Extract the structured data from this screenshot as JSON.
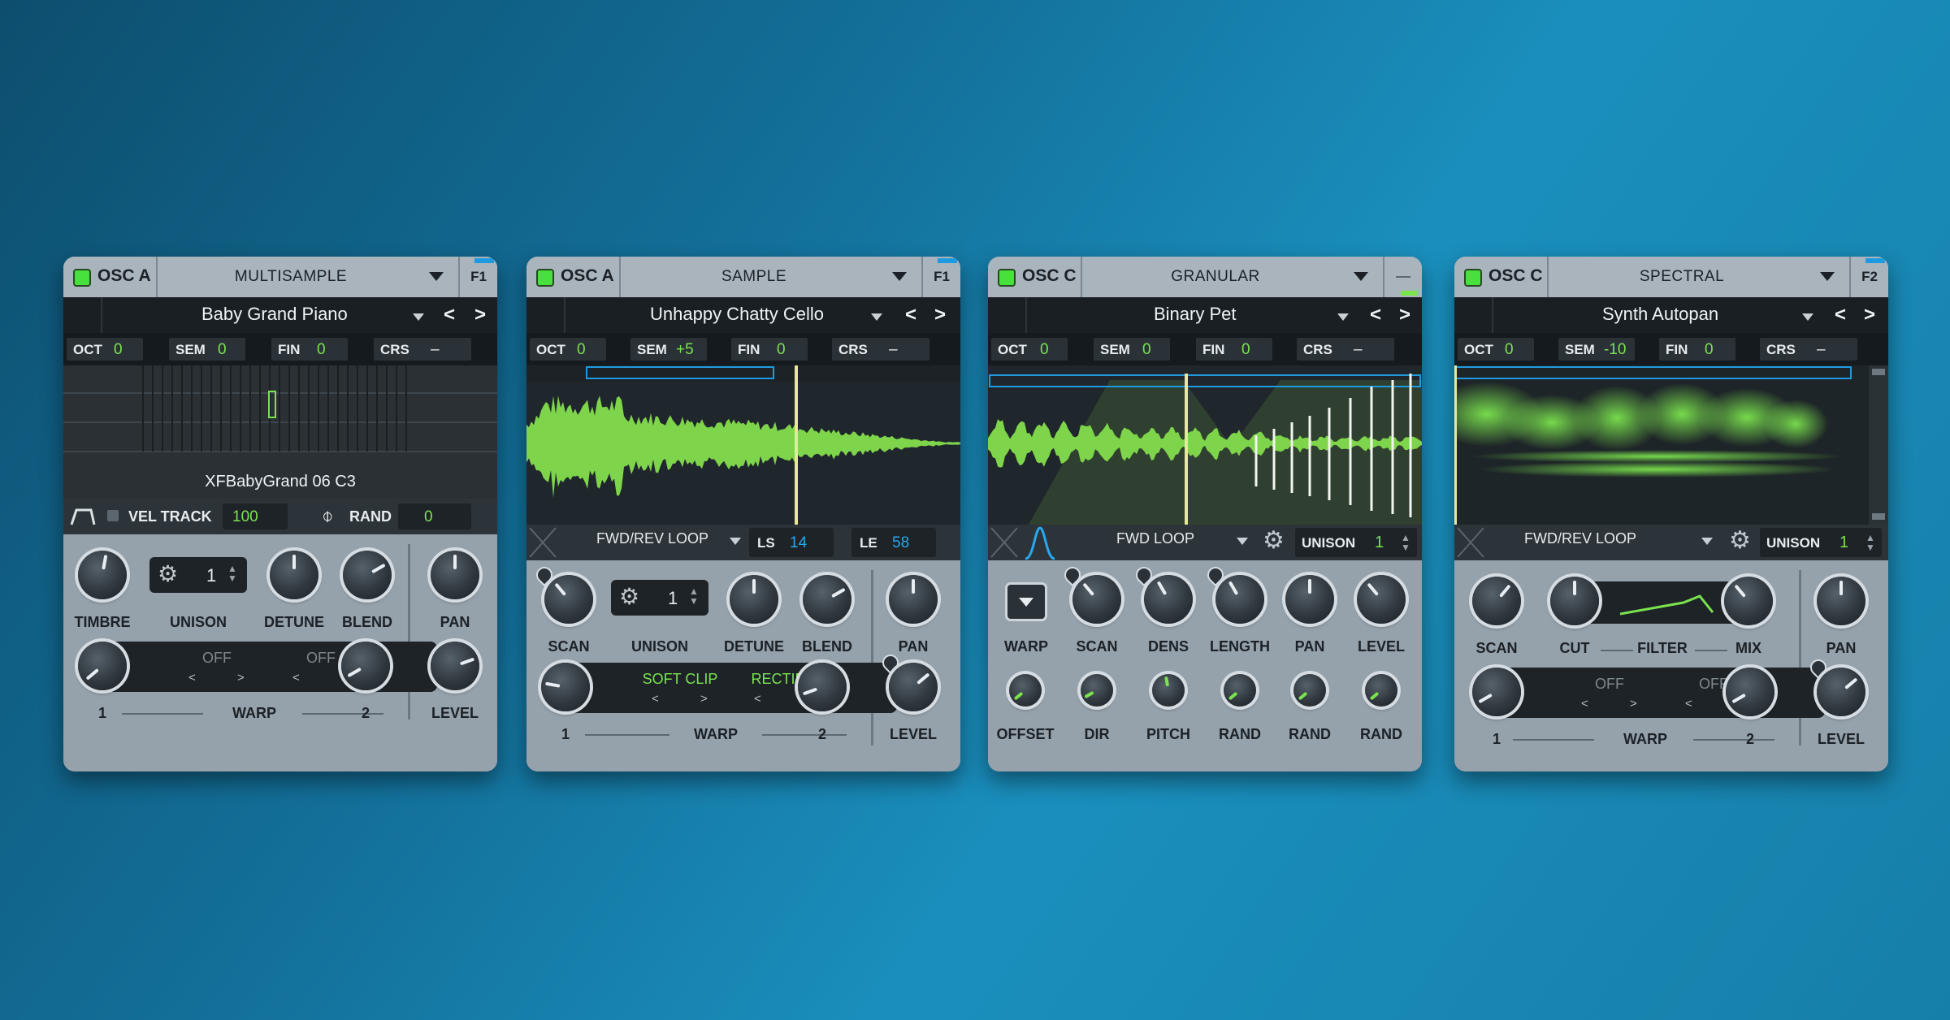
{
  "panels": [
    {
      "osc": "OSC A",
      "mode": "MULTISAMPLE",
      "f": "F1",
      "preset": "Baby Grand Piano",
      "tune": {
        "oct": "0",
        "sem": "0",
        "fin": "0",
        "crs": "–"
      },
      "sample_name": "XFBabyGrand 06 C3",
      "vel_track": "VEL TRACK",
      "vel_val": "100",
      "rand": "RAND",
      "rand_val": "0",
      "unison_val": "1",
      "labels": {
        "timbre": "TIMBRE",
        "unison": "UNISON",
        "detune": "DETUNE",
        "blend": "BLEND",
        "pan": "PAN",
        "level": "LEVEL",
        "warp": "WARP",
        "one": "1",
        "two": "2",
        "off1": "OFF",
        "off2": "OFF"
      }
    },
    {
      "osc": "OSC A",
      "mode": "SAMPLE",
      "f": "F1",
      "preset": "Unhappy Chatty Cello",
      "tune": {
        "oct": "0",
        "sem": "+5",
        "fin": "0",
        "crs": "–"
      },
      "loop": "FWD/REV LOOP",
      "ls": "LS",
      "ls_val": "14",
      "le": "LE",
      "le_val": "58",
      "unison_val": "1",
      "labels": {
        "scan": "SCAN",
        "unison": "UNISON",
        "detune": "DETUNE",
        "blend": "BLEND",
        "pan": "PAN",
        "level": "LEVEL",
        "warp": "WARP",
        "one": "1",
        "two": "2",
        "w1": "SOFT CLIP",
        "w2": "RECTIFY"
      }
    },
    {
      "osc": "OSC C",
      "mode": "GRANULAR",
      "f": "",
      "preset": "Binary Pet",
      "tune": {
        "oct": "0",
        "sem": "0",
        "fin": "0",
        "crs": "–"
      },
      "loop": "FWD LOOP",
      "unison": "UNISON",
      "unison_val": "1",
      "labels": {
        "warp": "WARP",
        "scan": "SCAN",
        "dens": "DENS",
        "length": "LENGTH",
        "pan": "PAN",
        "level": "LEVEL",
        "offset": "OFFSET",
        "dir": "DIR",
        "pitch": "PITCH",
        "rand1": "RAND",
        "rand2": "RAND",
        "rand3": "RAND"
      }
    },
    {
      "osc": "OSC C",
      "mode": "SPECTRAL",
      "f": "F2",
      "preset": "Synth Autopan",
      "tune": {
        "oct": "0",
        "sem": "-10",
        "fin": "0",
        "crs": "–"
      },
      "loop": "FWD/REV LOOP",
      "unison": "UNISON",
      "unison_val": "1",
      "labels": {
        "scan": "SCAN",
        "cut": "CUT",
        "filter": "FILTER",
        "mix": "MIX",
        "pan": "PAN",
        "level": "LEVEL",
        "warp": "WARP",
        "one": "1",
        "two": "2",
        "off1": "OFF",
        "off2": "OFF"
      }
    }
  ],
  "tune_labels": {
    "oct": "OCT",
    "sem": "SEM",
    "fin": "FIN",
    "crs": "CRS"
  },
  "colors": {
    "accent_green": "#7be34e",
    "led_green": "#47e03d",
    "loop_blue": "#1e9be0",
    "panel": "#9aa6b0"
  }
}
